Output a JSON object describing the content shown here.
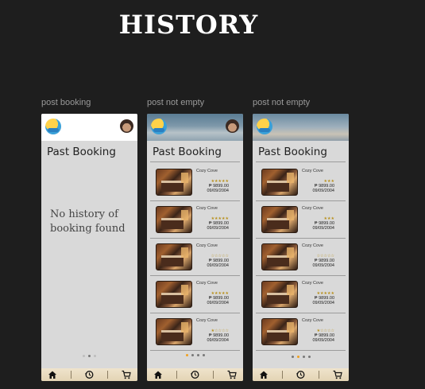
{
  "page_title": "HISTORY",
  "screens": [
    {
      "label": "post booking",
      "section_title": "Past Booking",
      "empty_message": "No history of booking found",
      "bookings": []
    },
    {
      "label": "post not empty",
      "section_title": "Past Booking",
      "bookings": [
        {
          "name": "Cozy Cove",
          "rating": 5,
          "stars": "★★★★★",
          "price": "₱ 9899.00",
          "date": "09/09/2004"
        },
        {
          "name": "Cozy Cove",
          "rating": 5,
          "stars": "★★★★★",
          "price": "₱ 9899.00",
          "date": "09/09/2004"
        },
        {
          "name": "Cozy Cove",
          "rating": 0,
          "stars": "☆☆☆☆☆",
          "price": "₱ 9899.00",
          "date": "09/09/2004"
        },
        {
          "name": "Cozy Cove",
          "rating": 5,
          "stars": "★★★★★",
          "price": "₱ 9899.00",
          "date": "09/09/2004"
        },
        {
          "name": "Cozy Cove",
          "rating": 1,
          "stars": "★☆☆☆☆",
          "price": "₱ 9899.00",
          "date": "09/09/2004"
        }
      ]
    },
    {
      "label": "post not empty",
      "section_title": "Past Booking",
      "bookings": [
        {
          "name": "Cozy Cove",
          "rating": 3,
          "stars": "★★★",
          "price": "₱ 9899.00",
          "date": "09/09/2004"
        },
        {
          "name": "Cozy Cove",
          "rating": 3,
          "stars": "★★★",
          "price": "₱ 9899.00",
          "date": "09/09/2004"
        },
        {
          "name": "Cozy Cove",
          "rating": 0,
          "stars": "☆☆☆☆☆",
          "price": "₱ 9899.00",
          "date": "09/09/2004"
        },
        {
          "name": "Cozy Cove",
          "rating": 5,
          "stars": "★★★★★",
          "price": "₱ 9899.00",
          "date": "09/09/2004"
        },
        {
          "name": "Cozy Cove",
          "rating": 1,
          "stars": "★☆☆☆☆",
          "price": "₱ 9899.00",
          "date": "09/09/2004"
        }
      ]
    }
  ],
  "nav_icons": [
    "home-icon",
    "history-icon",
    "cart-icon"
  ],
  "colors": {
    "background": "#1e1e1e",
    "accent_dot": "#f0a020",
    "star": "#b8901a",
    "navbar": "#e8dcc0"
  }
}
